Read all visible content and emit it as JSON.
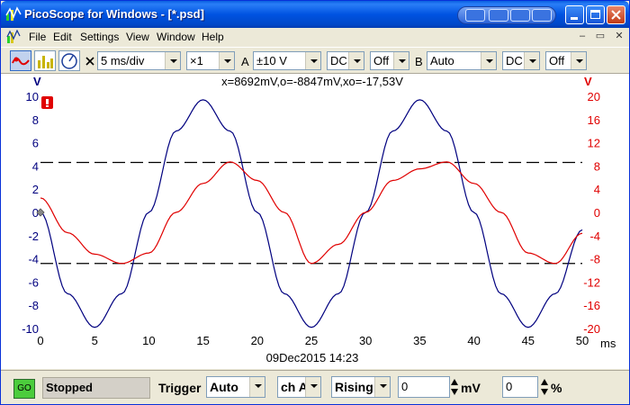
{
  "window": {
    "title": "PicoScope for Windows - [*.psd]"
  },
  "menu": {
    "items": [
      "File",
      "Edit",
      "Settings",
      "View",
      "Window",
      "Help"
    ]
  },
  "toolbar": {
    "timebase": "5 ms/div",
    "multiplier": "×1",
    "channel_a_label": "A",
    "channel_a_range": "±10 V",
    "channel_a_coupling": "DC",
    "channel_a_offset": "Off",
    "channel_b_label": "B",
    "channel_b_range": "Auto",
    "channel_b_coupling": "DC",
    "channel_b_offset": "Off"
  },
  "scope": {
    "cursor_readout": "x=8692mV,o=-8847mV,xo=-17,53V",
    "timestamp": "09Dec2015  14:23",
    "x_unit": "ms",
    "left_unit": "V",
    "right_unit": "V",
    "warning_icon": "exclamation-icon",
    "colors": {
      "channel_a": "#00007f",
      "channel_b": "#e00000",
      "grid_dash": "#000000"
    }
  },
  "chart_data": {
    "type": "line",
    "xlabel": "ms",
    "ylabel": "V",
    "xlim": [
      0,
      50
    ],
    "x_ticks": [
      "0",
      "5",
      "10",
      "15",
      "20",
      "25",
      "30",
      "35",
      "40",
      "45",
      "50"
    ],
    "ylim_left": [
      -10,
      10
    ],
    "left_ticks": [
      "10",
      "8",
      "6",
      "4",
      "2",
      "0",
      "-2",
      "-4",
      "-6",
      "-8",
      "-10"
    ],
    "ylim_right": [
      -20,
      20
    ],
    "right_ticks": [
      "20",
      "16",
      "12",
      "8",
      "4",
      "0",
      "-4",
      "-8",
      "-12",
      "-16",
      "-20"
    ],
    "series": [
      {
        "axis": "left",
        "color": "#00007f",
        "x": [
          0,
          2.5,
          5,
          7.5,
          10,
          12.5,
          15,
          17.5,
          20,
          22.5,
          25,
          27.5,
          30,
          32.5,
          35,
          37.5,
          40,
          42.5,
          45,
          47.5,
          50
        ],
        "values": [
          0,
          -7.0,
          -9.9,
          -7.0,
          0,
          7.0,
          9.7,
          7.0,
          0,
          -7.0,
          -9.9,
          -7.0,
          0,
          7.0,
          9.7,
          7.0,
          0,
          -7.0,
          -9.9,
          -7.0,
          -1.5
        ]
      },
      {
        "axis": "right",
        "color": "#e00000",
        "x": [
          0,
          2.5,
          5,
          7.5,
          10,
          12.5,
          15,
          17.5,
          20,
          22.5,
          25,
          27.5,
          30,
          32.5,
          35,
          37.5,
          40,
          42.5,
          45,
          47.5,
          50
        ],
        "values": [
          2.5,
          -3.5,
          -7.2,
          -8.8,
          -7.0,
          0,
          5.0,
          8.7,
          5.5,
          0,
          -8.8,
          -5.5,
          0,
          5.5,
          7.5,
          8.7,
          5.0,
          0,
          -7.0,
          -8.8,
          -3.6
        ]
      }
    ],
    "markers": [
      {
        "axis": "left",
        "value": 4.3
      },
      {
        "axis": "left",
        "value": -4.4
      }
    ]
  },
  "statusbar": {
    "go_label": "GO",
    "status": "Stopped",
    "trigger_label": "Trigger",
    "trigger_mode": "Auto",
    "trigger_channel": "ch A",
    "trigger_edge": "Rising",
    "threshold_value": "0",
    "threshold_unit": "mV",
    "delay_value": "0",
    "delay_unit": "%"
  }
}
